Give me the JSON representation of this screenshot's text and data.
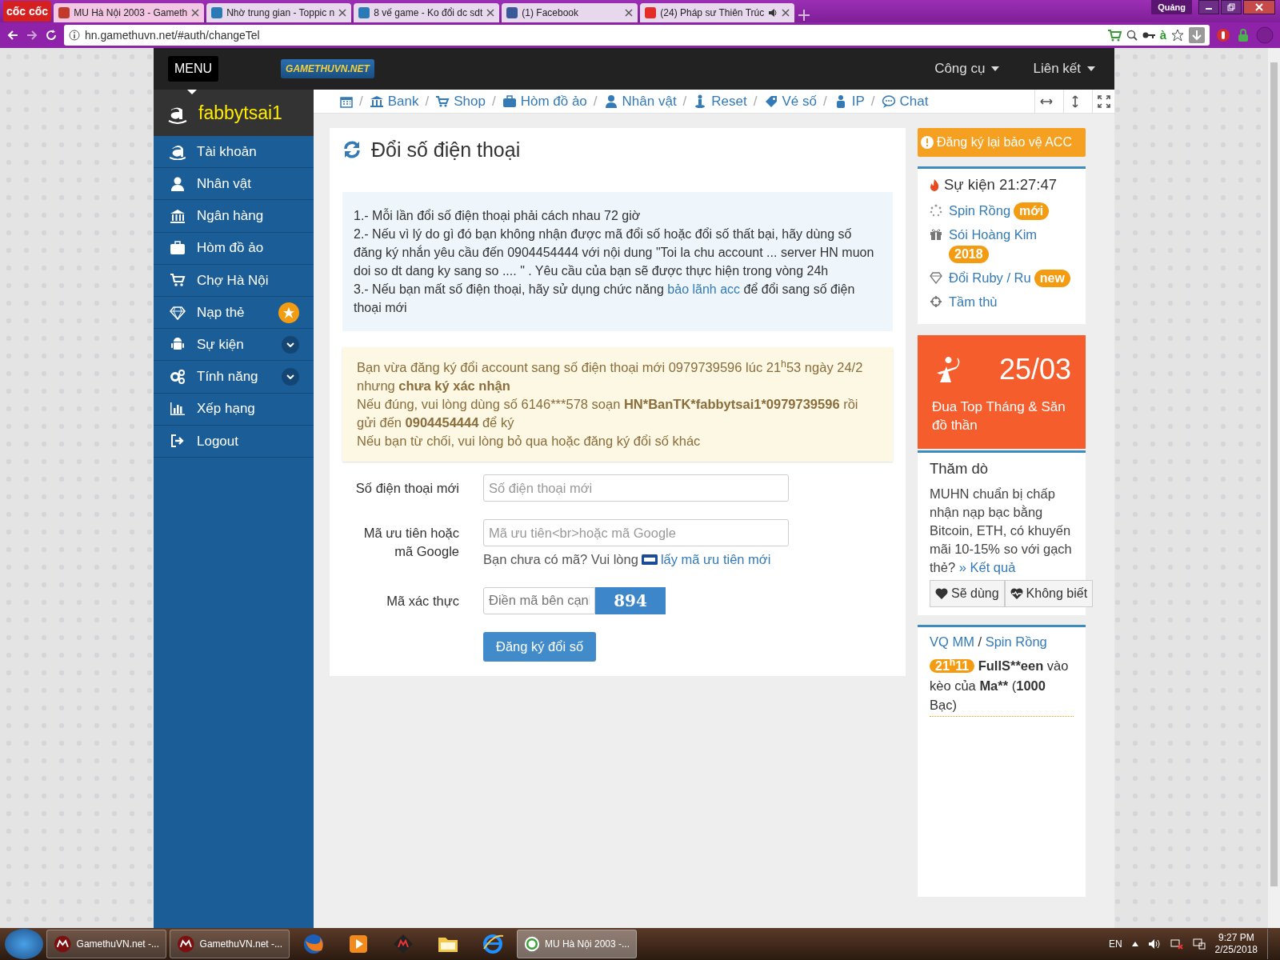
{
  "browser": {
    "brand": "cốc cốc",
    "tabs": [
      {
        "label": "MU Hà Nội 2003 - Gameth",
        "selected": true,
        "audio": false
      },
      {
        "label": "Nhờ trung gian - Toppic n",
        "selected": false,
        "audio": false
      },
      {
        "label": "8 vế game - Ko đổi dc sdt",
        "selected": false,
        "audio": false
      },
      {
        "label": "(1) Facebook",
        "selected": false,
        "audio": false
      },
      {
        "label": "(24) Pháp sư Thiên Trúc",
        "selected": false,
        "audio": true
      }
    ],
    "profile": "Quảng",
    "address": "hn.gamethuvn.net/#auth/changeTel",
    "dictionary_button": "à"
  },
  "navbar": {
    "menu_button": "MENU",
    "logo": "GAMETHUVN.NET",
    "dropdowns": [
      "Công cụ",
      "Liên kết"
    ]
  },
  "user": {
    "name": "fabbytsai1"
  },
  "sidebar": {
    "items": [
      {
        "label": "Tài khoản",
        "kind": "plain"
      },
      {
        "label": "Nhân vật",
        "kind": "plain"
      },
      {
        "label": "Ngân hàng",
        "kind": "plain"
      },
      {
        "label": "Hòm đồ ảo",
        "kind": "plain"
      },
      {
        "label": "Chợ Hà Nội",
        "kind": "plain"
      },
      {
        "label": "Nạp thẻ",
        "kind": "star"
      },
      {
        "label": "Sự kiện",
        "kind": "expand"
      },
      {
        "label": "Tính năng",
        "kind": "expand"
      },
      {
        "label": "Xếp hạng",
        "kind": "plain"
      },
      {
        "label": "Logout",
        "kind": "plain"
      }
    ]
  },
  "breadcrumb": {
    "separator": "/",
    "items": [
      "Bank",
      "Shop",
      "Hòm đồ ảo",
      "Nhân vật",
      "Reset",
      "Vé số",
      "IP",
      "Chat"
    ]
  },
  "page_title": "Đổi số điện thoại",
  "info": {
    "lines": [
      {
        "text": "1.- Mỗi lần đổi số điện thoại phải cách nhau 72 giờ"
      },
      {
        "text": "2.- Nếu vì lý do gì đó bạn không nhận được mã đổi số hoặc đổi số thất bại, hãy dùng số đăng ký nhắn yêu cầu đến 0904454444 với nội dung \"Toi la chu account ... server HN muon doi so dt dang ky sang so .... \" . Yêu cầu của bạn sẽ được thực hiện trong vòng 24h"
      },
      {
        "text": "3.- Nếu bạn mất số điện thoại, hãy sử dụng chức năng",
        "link": "bảo lãnh acc",
        "after": "để đổi sang số điện thoại mới"
      }
    ]
  },
  "warning": {
    "lines": [
      [
        {
          "text": "Bạn vừa đăng ký đổi account sang số điện thoại mới 0979739596 lúc 21",
          "kind": "plain"
        },
        {
          "text": "h",
          "kind": "superscript"
        },
        {
          "text": "53 ngày 24/2 nhưng ",
          "kind": "plain"
        },
        {
          "text": "chưa ký xác nhận",
          "kind": "emphasis"
        }
      ],
      [
        {
          "text": "Nếu đúng, vui lòng dùng số 6146***578 soạn ",
          "kind": "plain"
        },
        {
          "text": "HN*BanTK*fabbytsai1*0979739596",
          "kind": "emphasis"
        },
        {
          "text": " rồi gửi đến ",
          "kind": "plain"
        },
        {
          "text": "0904454444",
          "kind": "emphasis"
        },
        {
          "text": " để ký",
          "kind": "plain"
        }
      ],
      [
        {
          "text": "Nếu bạn từ chối, vui lòng bỏ qua hoặc đăng ký đổi số khác",
          "kind": "plain"
        }
      ]
    ]
  },
  "form": {
    "fields": [
      {
        "label": "Số điện thoại mới",
        "placeholder": "Số điện thoại mới",
        "kind": "text"
      },
      {
        "label": "Mã ưu tiên hoặc mã Google",
        "placeholder": "Mã ưu tiên<br>hoặc mã Google",
        "kind": "hint",
        "hint": "Bạn chưa có mã? Vui lòng",
        "hint_link": "lấy mã ưu tiên mới"
      },
      {
        "label": "Mã xác thực",
        "placeholder": "Điền mã bên cạnl",
        "kind": "captcha",
        "captcha": "894"
      }
    ],
    "submit": "Đăng ký đổi số"
  },
  "right": {
    "alert_button": "Đăng ký lại bảo vệ ACC",
    "events": {
      "title": "Sự kiện 21:27:47",
      "items": [
        {
          "label": "Spin Rồng",
          "badge": "mới"
        },
        {
          "label": "Sói Hoàng Kim",
          "badge": "2018"
        },
        {
          "label": "Đổi Ruby / Ru",
          "badge": "new"
        },
        {
          "label": "Tầm thù"
        }
      ]
    },
    "promo": {
      "date": "25/03",
      "text": "Đua Top Tháng & Săn đồ thần"
    },
    "poll": {
      "title": "Thăm dò",
      "question": "MUHN chuẩn bị chấp nhận nạp bạc bằng Bitcoin, ETH, có khuyến mãi 10-15% so với gạch thẻ?",
      "result_link": "» Kết quả",
      "buttons": [
        "Sẽ dùng",
        "Không biết"
      ]
    },
    "feed": {
      "links": [
        "VQ MM",
        "Spin Rồng"
      ],
      "separator": "/",
      "entries": [
        {
          "time": "21$^{h}$11",
          "segments": [
            {
              "text": "FullS**een",
              "kind": "emphasis"
            },
            {
              "text": " vào kèo của ",
              "kind": "plain"
            },
            {
              "text": "Ma**",
              "kind": "emphasis"
            },
            {
              "text": " (",
              "kind": "plain"
            },
            {
              "text": "1000",
              "kind": "emphasis"
            },
            {
              "text": " Bạc)",
              "kind": "plain"
            }
          ]
        }
      ]
    }
  },
  "taskbar": {
    "items": [
      {
        "label": "GamethuVN.net -...",
        "kind": "window",
        "selected": false
      },
      {
        "label": "GamethuVN.net -...",
        "kind": "window",
        "selected": false
      },
      {
        "kind": "firefox"
      },
      {
        "kind": "media"
      },
      {
        "kind": "game"
      },
      {
        "kind": "folder"
      },
      {
        "kind": "ie"
      },
      {
        "label": "MU Hà Nội 2003 -...",
        "kind": "window",
        "selected": true
      }
    ],
    "language": "EN",
    "time": "9:27 PM",
    "date": "2/25/2018"
  }
}
